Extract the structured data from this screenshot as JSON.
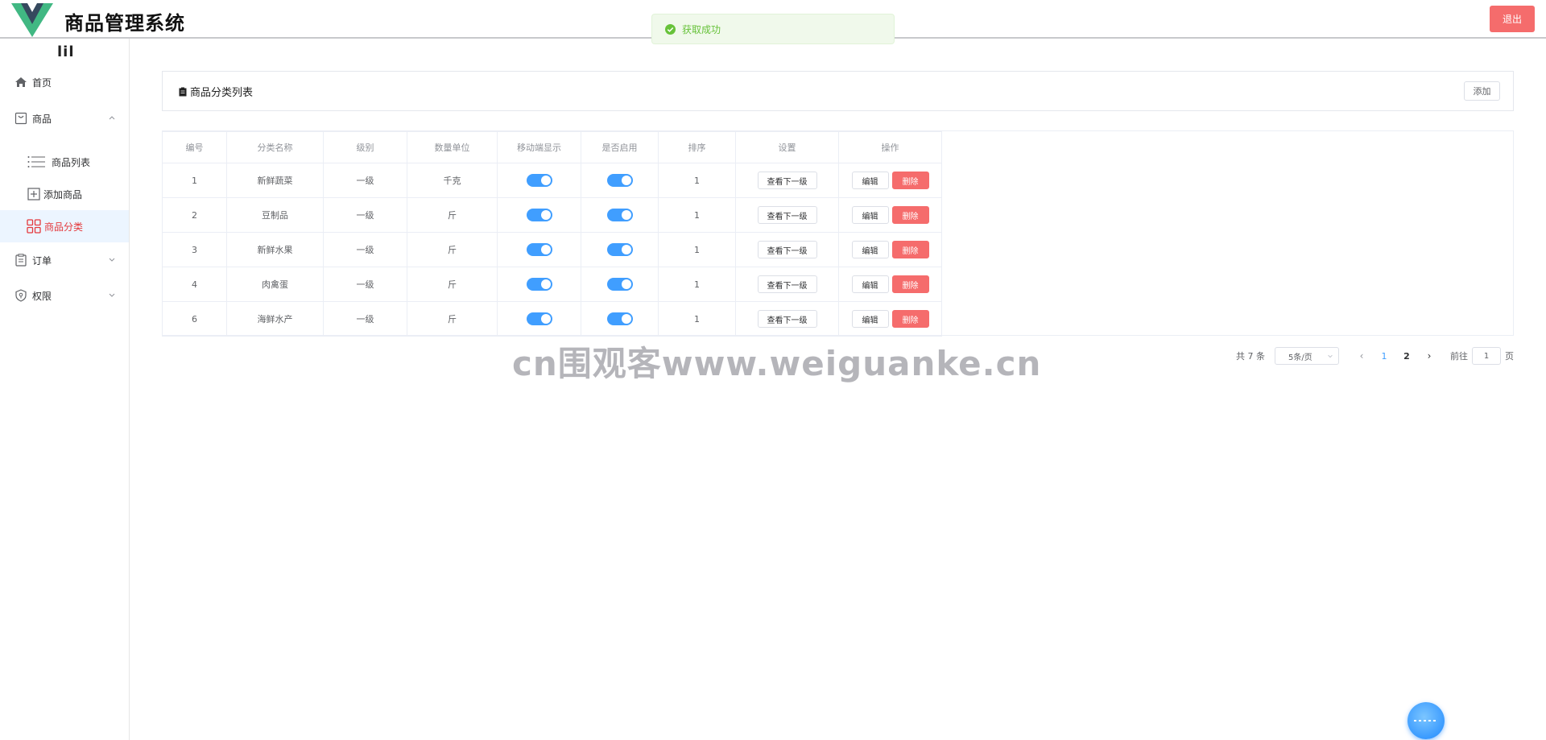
{
  "header": {
    "title": "商品管理系统",
    "logout_label": "退出"
  },
  "toast": {
    "text": "获取成功",
    "color": "#67c23a"
  },
  "sidebar": {
    "collapse_toggle": "lil",
    "items": [
      {
        "label": "首页",
        "icon": "home-icon"
      },
      {
        "label": "商品",
        "icon": "goods-icon",
        "expanded": true
      },
      {
        "label": "商品列表",
        "icon": "list-icon"
      },
      {
        "label": "添加商品",
        "icon": "plus-square-icon"
      },
      {
        "label": "商品分类",
        "icon": "category-grid-icon",
        "active": true
      },
      {
        "label": "订单",
        "icon": "clipboard-icon"
      },
      {
        "label": "权限",
        "icon": "shield-icon"
      }
    ]
  },
  "card": {
    "title": "商品分类列表",
    "add_label": "添加"
  },
  "table": {
    "headers": [
      "编号",
      "分类名称",
      "级别",
      "数量单位",
      "移动端显示",
      "是否启用",
      "排序",
      "设置",
      "操作"
    ],
    "rows": [
      {
        "id": "1",
        "name": "新鲜蔬菜",
        "level": "一级",
        "unit": "千克",
        "mobile_show": true,
        "enabled": true,
        "sort": "1"
      },
      {
        "id": "2",
        "name": "豆制品",
        "level": "一级",
        "unit": "斤",
        "mobile_show": true,
        "enabled": true,
        "sort": "1"
      },
      {
        "id": "3",
        "name": "新鲜水果",
        "level": "一级",
        "unit": "斤",
        "mobile_show": true,
        "enabled": true,
        "sort": "1"
      },
      {
        "id": "4",
        "name": "肉禽蛋",
        "level": "一级",
        "unit": "斤",
        "mobile_show": true,
        "enabled": true,
        "sort": "1"
      },
      {
        "id": "6",
        "name": "海鲜水产",
        "level": "一级",
        "unit": "斤",
        "mobile_show": true,
        "enabled": true,
        "sort": "1"
      }
    ],
    "sub_label": "查看下一级",
    "edit_label": "编辑",
    "delete_label": "删除"
  },
  "pagination": {
    "total": "共 7 条",
    "page_size": "5条/页",
    "pages": [
      "1",
      "2"
    ],
    "current": "1",
    "goto_prefix": "前往",
    "goto_value": "1",
    "goto_suffix": "页"
  },
  "watermark": "cn围观客www.weiguanke.cn",
  "colors": {
    "accent": "#409eff",
    "danger": "#f56c6c",
    "success": "#67c23a",
    "active_menu": "#e4393c"
  }
}
